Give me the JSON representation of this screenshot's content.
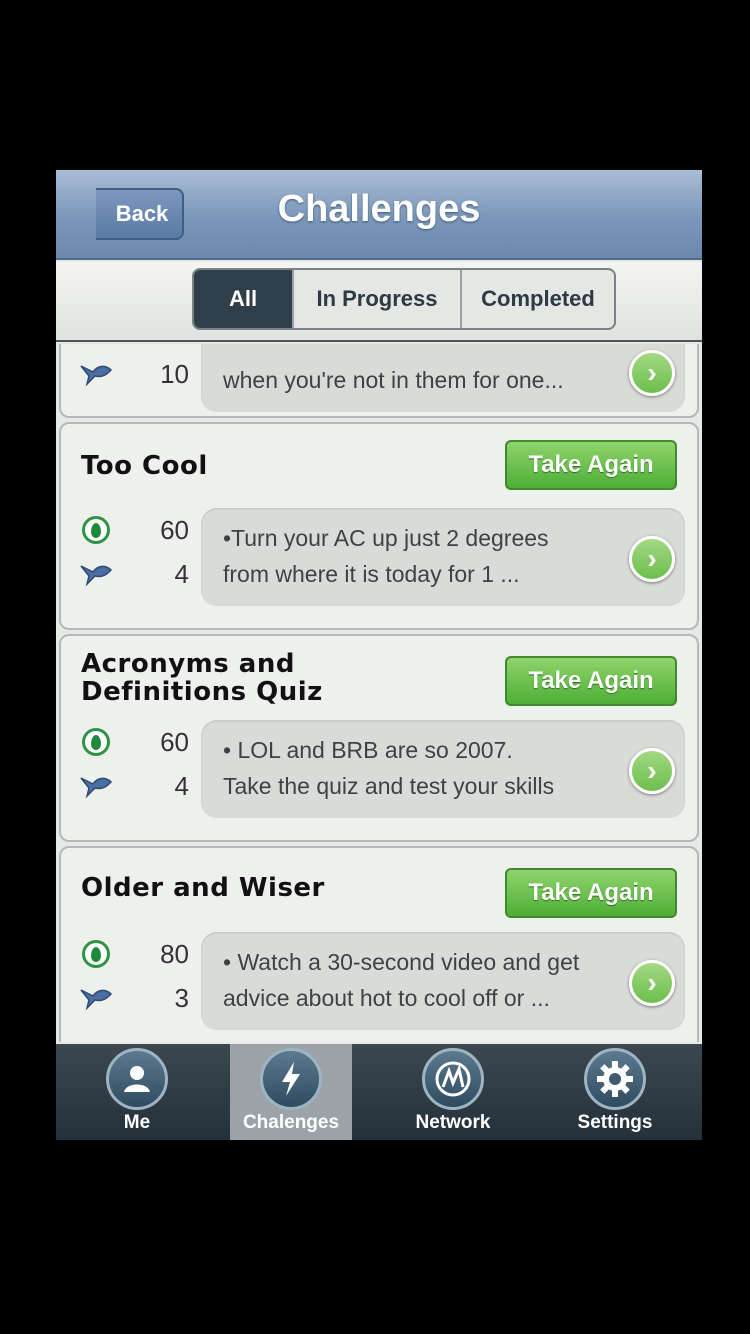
{
  "navbar": {
    "back_label": "Back",
    "title": "Challenges"
  },
  "filter": {
    "tabs": [
      "All",
      "In Progress",
      "Completed"
    ],
    "selected": "All"
  },
  "challenges": [
    {
      "title": "",
      "points": "",
      "people": "10",
      "description": "when you're not in  them for one...",
      "action_label": ""
    },
    {
      "title": "Too Cool",
      "points": "60",
      "people": "4",
      "description": "•Turn your AC up just 2 degrees\n from where it is today for 1 ...",
      "action_label": "Take Again"
    },
    {
      "title": "Acronyms and\nDefinitions Quiz",
      "points": "60",
      "people": "4",
      "description": "• LOL and BRB are so 2007.\nTake the quiz and test your skills",
      "action_label": "Take Again"
    },
    {
      "title": "Older and Wiser",
      "points": "80",
      "people": "3",
      "description": "• Watch a 30-second video and get\nadvice about hot to cool off or ...",
      "action_label": "Take Again"
    }
  ],
  "tabbar": {
    "items": [
      {
        "label": "Me",
        "icon": "person-icon"
      },
      {
        "label": "Chalenges",
        "icon": "lightning-icon"
      },
      {
        "label": "Network",
        "icon": "network-icon"
      },
      {
        "label": "Settings",
        "icon": "gear-icon"
      }
    ],
    "selected": "Chalenges"
  },
  "colors": {
    "nav": "#7a96b9",
    "accent_green": "#5cb83f",
    "tab_bg": "#2f3b44"
  }
}
